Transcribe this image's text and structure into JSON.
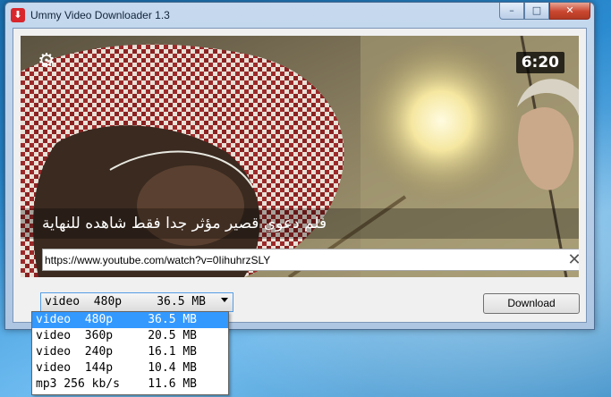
{
  "window": {
    "title": "Ummy Video Downloader 1.3",
    "minimize_label": "–",
    "maximize_label": "□",
    "close_label": "✕"
  },
  "video": {
    "duration": "6:20",
    "title": "فلم دعوي قصير مؤثر جدا فقط شاهده للنهاية",
    "settings_icon": "gear-icon",
    "url": "https://www.youtube.com/watch?v=0IihuhrzSLY",
    "clear_label": "✕"
  },
  "format_select": {
    "selected": "video  480p     36.5 MB"
  },
  "download_label": "Download",
  "options": [
    {
      "label": "video  480p     36.5 MB",
      "selected": true
    },
    {
      "label": "video  360p     20.5 MB",
      "selected": false
    },
    {
      "label": "video  240p     16.1 MB",
      "selected": false
    },
    {
      "label": "video  144p     10.4 MB",
      "selected": false
    },
    {
      "label": "mp3 256 kb/s    11.6 MB",
      "selected": false
    }
  ],
  "colors": {
    "selection": "#3399ff",
    "close_button": "#c9462f"
  }
}
